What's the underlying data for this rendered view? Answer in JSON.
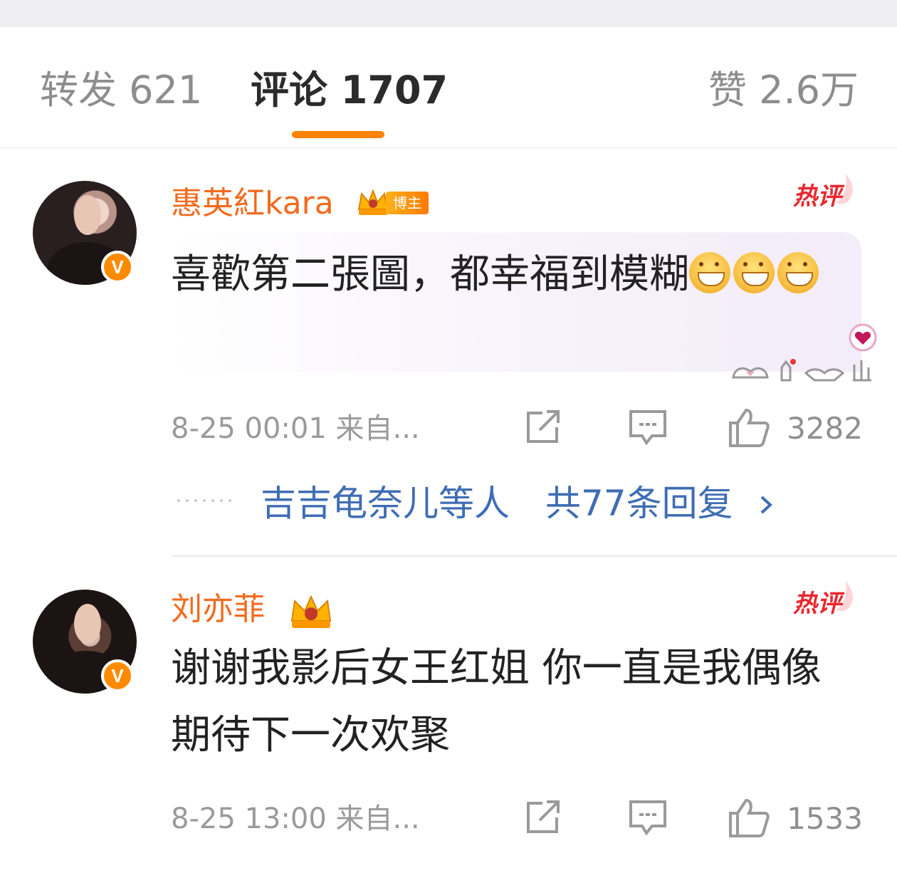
{
  "tabs": {
    "reposts": "转发 621",
    "comments": "评论 1707",
    "likes": "赞 2.6万",
    "active_color": "#ff8200"
  },
  "comments": [
    {
      "username": "惠英紅kara",
      "badge_label": "博主",
      "hot_label": "热评",
      "text": "喜歡第二張圖，都幸福到模糊",
      "emoji_count": 3,
      "emoji_name": "grin-emoji",
      "time": "8-25 00:01  来自...",
      "likes": "3282",
      "replies": {
        "names": "吉吉龟奈儿等人",
        "count": "共77条回复"
      }
    },
    {
      "username": "刘亦菲",
      "hot_label": "热评",
      "text": "谢谢我影后女王红姐 你一直是我偶像 期待下一次欢聚",
      "time": "8-25 13:00  来自...",
      "likes": "1533"
    }
  ],
  "colors": {
    "username": "#f26a1d",
    "hot": "#e8282f",
    "link": "#3f6db4",
    "verified": "#ff8a00"
  }
}
